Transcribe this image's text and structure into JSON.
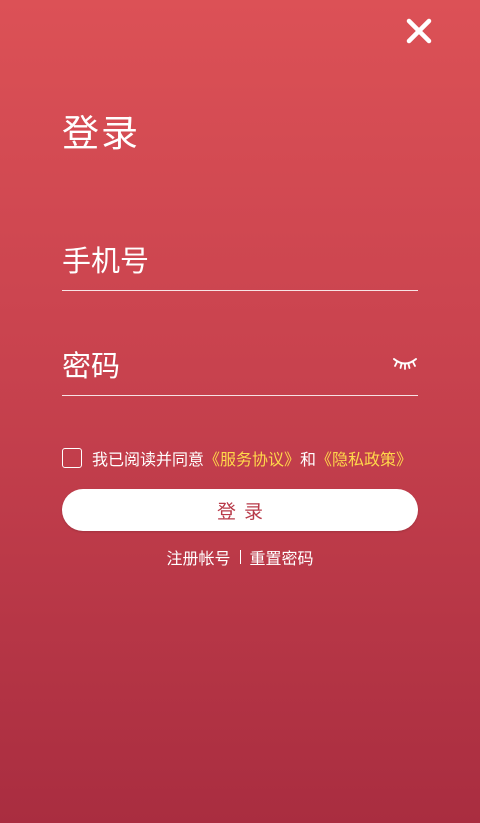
{
  "header": {
    "title": "登录"
  },
  "form": {
    "phone_placeholder": "手机号",
    "password_placeholder": "密码"
  },
  "agreement": {
    "prefix": "我已阅读并同意",
    "service_link": "《服务协议》",
    "and": "和",
    "privacy_link": "《隐私政策》",
    "checked": false
  },
  "actions": {
    "login_label": "登录",
    "register_label": "注册帐号",
    "reset_label": "重置密码"
  },
  "colors": {
    "gradient_top": "#dc5156",
    "gradient_bottom": "#a92d40",
    "link": "#ffd84a",
    "button_text": "#b83a49"
  },
  "icons": {
    "close": "close-icon",
    "password_visibility": "eye-closed-icon"
  }
}
